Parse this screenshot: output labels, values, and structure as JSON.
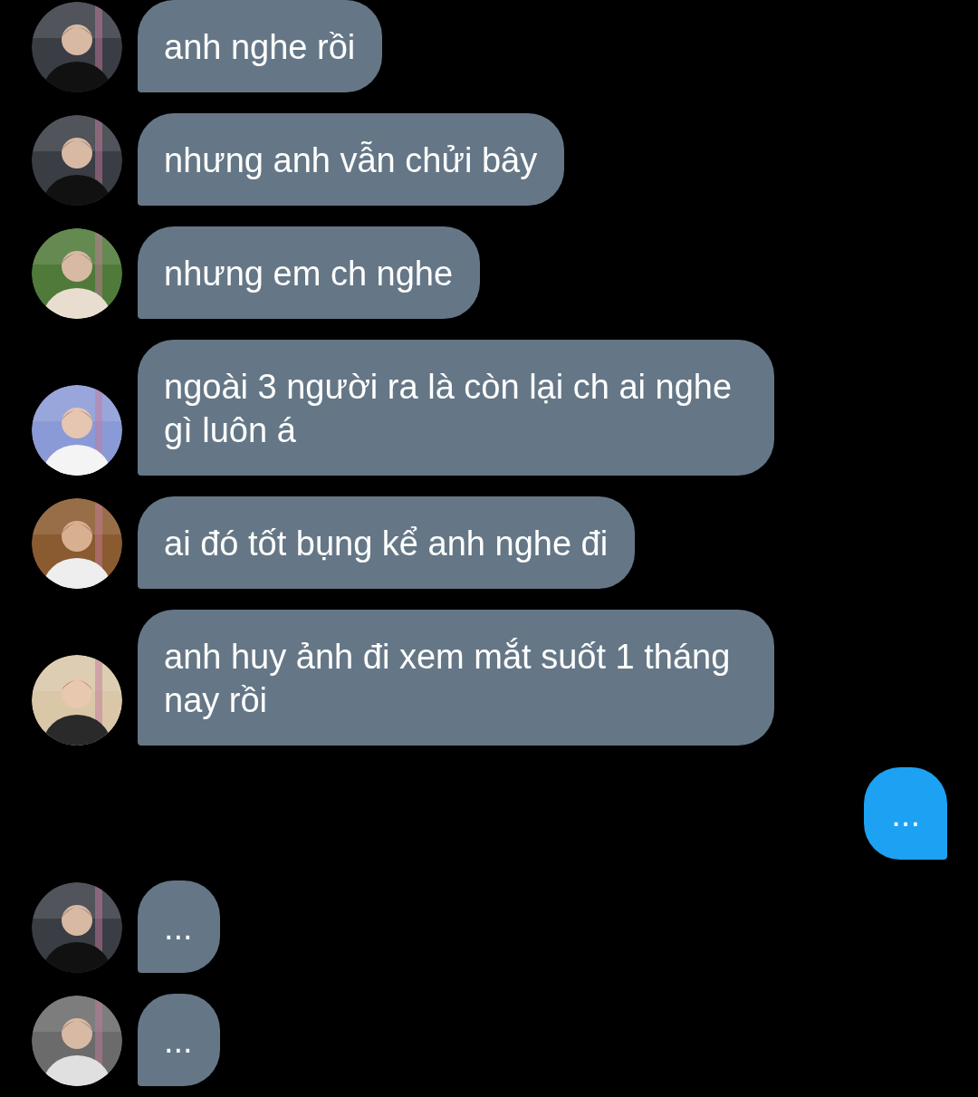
{
  "messages": [
    {
      "kind": "incoming",
      "text": "anh nghe rồi"
    },
    {
      "kind": "incoming",
      "text": "nhưng anh vẫn chửi bây"
    },
    {
      "kind": "incoming",
      "text": "nhưng em ch nghe"
    },
    {
      "kind": "incoming",
      "text": "ngoài 3 người ra là còn lại ch ai nghe gì luôn á"
    },
    {
      "kind": "incoming",
      "text": "ai đó tốt bụng kể anh nghe đi"
    },
    {
      "kind": "incoming",
      "text": "anh huy ảnh đi xem mắt suốt 1 tháng nay rồi"
    },
    {
      "kind": "outgoing",
      "text": "..."
    },
    {
      "kind": "incoming",
      "text": "..."
    },
    {
      "kind": "incoming",
      "text": "..."
    }
  ]
}
